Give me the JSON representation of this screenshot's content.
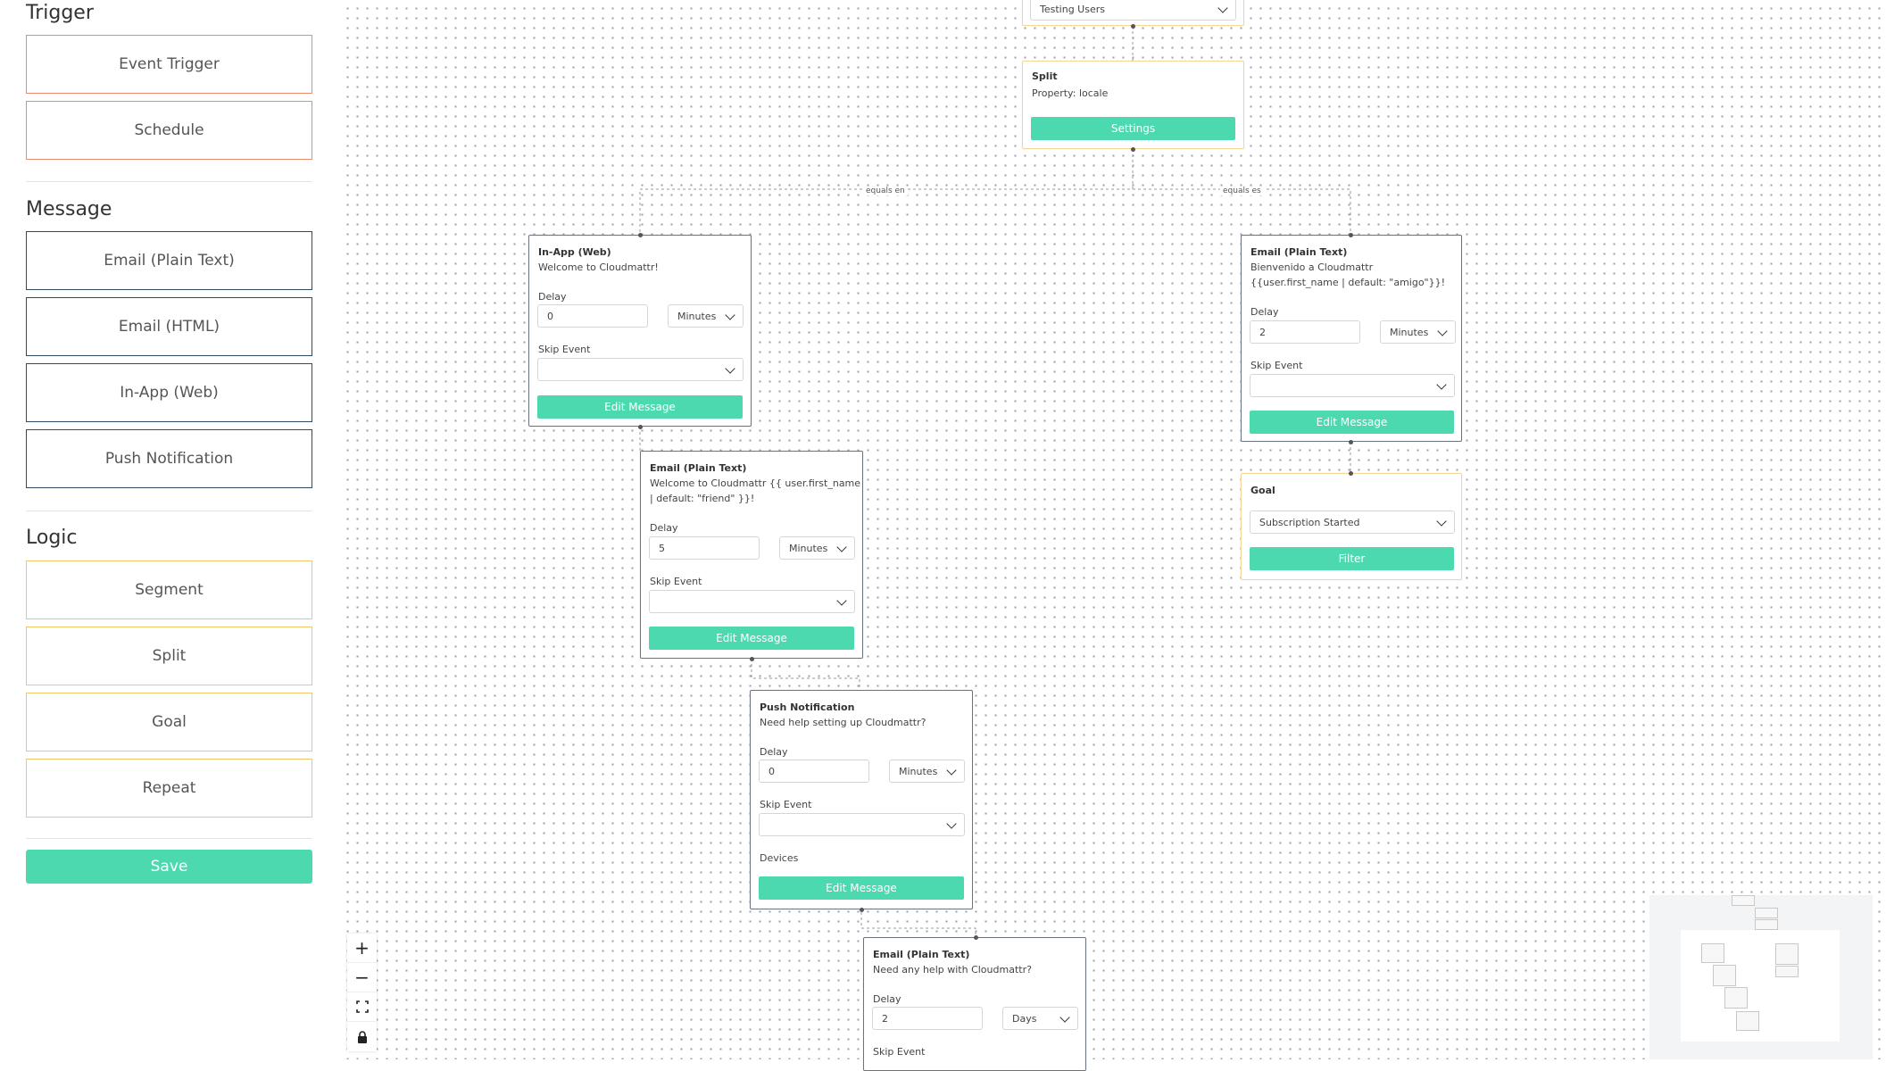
{
  "sidebar": {
    "trigger_title": "Trigger",
    "trigger_items": [
      "Event Trigger",
      "Schedule"
    ],
    "message_title": "Message",
    "message_items": [
      "Email (Plain Text)",
      "Email (HTML)",
      "In-App (Web)",
      "Push Notification"
    ],
    "logic_title": "Logic",
    "logic_items": [
      "Segment",
      "Split",
      "Goal",
      "Repeat"
    ],
    "save_label": "Save"
  },
  "colors": {
    "accent": "#4dd9b0",
    "trigger_border": "#f08a6e",
    "message_border": "#2f4a66",
    "logic_border": "#f4c766"
  },
  "canvas": {
    "segment_node": {
      "select_value": "Testing Users"
    },
    "split_node": {
      "title": "Split",
      "property": "Property: locale",
      "button": "Settings"
    },
    "edge_labels": {
      "left": "equals en",
      "right": "equals es"
    },
    "inapp_node": {
      "title": "In-App (Web)",
      "subtitle": "Welcome to Cloudmattr!",
      "delay_label": "Delay",
      "delay_value": "0",
      "unit": "Minutes",
      "skip_label": "Skip Event",
      "button": "Edit Message"
    },
    "email_es_node": {
      "title": "Email (Plain Text)",
      "line1": "Bienvenido a Cloudmattr",
      "line2": "{{user.first_name | default: \"amigo\"}}!",
      "delay_label": "Delay",
      "delay_value": "2",
      "unit": "Minutes",
      "skip_label": "Skip Event",
      "button": "Edit Message"
    },
    "goal_node": {
      "title": "Goal",
      "select_value": "Subscription Started",
      "button": "Filter"
    },
    "email_en_node": {
      "title": "Email (Plain Text)",
      "line1": "Welcome to Cloudmattr {{ user.first_name",
      "line2": "| default: \"friend\" }}!",
      "delay_label": "Delay",
      "delay_value": "5",
      "unit": "Minutes",
      "skip_label": "Skip Event",
      "button": "Edit Message"
    },
    "push_node": {
      "title": "Push Notification",
      "subtitle": "Need help setting up Cloudmattr?",
      "delay_label": "Delay",
      "delay_value": "0",
      "unit": "Minutes",
      "skip_label": "Skip Event",
      "devices_label": "Devices",
      "button": "Edit Message"
    },
    "email_followup_node": {
      "title": "Email (Plain Text)",
      "subtitle": "Need any help with Cloudmattr?",
      "delay_label": "Delay",
      "delay_value": "2",
      "unit": "Days",
      "skip_label": "Skip Event"
    }
  },
  "controls": {
    "zoom_in": "+",
    "zoom_out": "−",
    "fit": "⛶",
    "lock": "🔒"
  }
}
